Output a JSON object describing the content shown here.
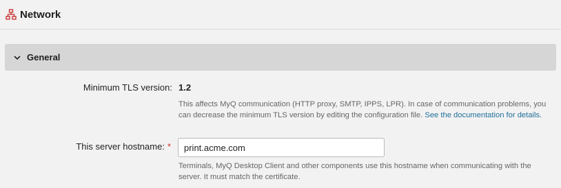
{
  "page": {
    "title": "Network",
    "icon": "network-icon"
  },
  "section": {
    "title": "General",
    "icon": "chevron-down-icon",
    "expanded": true
  },
  "tls": {
    "label": "Minimum TLS version:",
    "value": "1.2",
    "help_text": "This affects MyQ communication (HTTP proxy, SMTP, IPPS, LPR). In case of communication problems, you can decrease the minimum TLS version by editing the configuration file. ",
    "help_link": "See the documentation for details."
  },
  "hostname": {
    "label": "This server hostname:",
    "required_marker": "*",
    "value": "print.acme.com",
    "help_text": "Terminals, MyQ Desktop Client and other components use this hostname when communicating with the server. It must match the certificate."
  },
  "colors": {
    "required": "#d32f2f",
    "link": "#1f6f9a",
    "network_icon": "#c62828"
  }
}
